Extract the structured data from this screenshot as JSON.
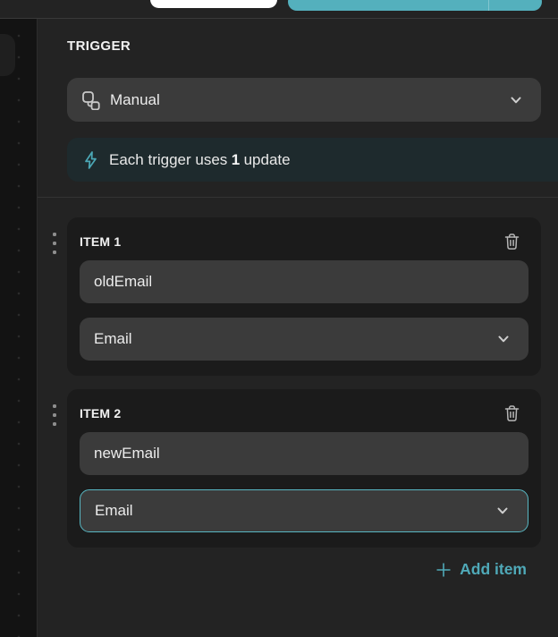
{
  "colors": {
    "accent_teal": "#54b0bd",
    "focus_border": "#58b7c3",
    "add_item_teal": "#4fa9b8",
    "panel_bg": "#232323",
    "card_bg": "#1b1b1b",
    "control_bg": "#3b3b3b",
    "notice_bg": "#1e2a2d",
    "secondary_button_color": "#ffffff"
  },
  "trigger_section": {
    "label": "TRIGGER",
    "type_select": {
      "value": "Manual",
      "icon": "workflow-nodes-icon",
      "chevron_icon": "chevron-down-icon"
    },
    "notice": {
      "icon": "lightning-icon",
      "prefix": "Each trigger uses",
      "count": "1",
      "suffix": "update"
    }
  },
  "items": [
    {
      "label": "ITEM 1",
      "name_value": "oldEmail",
      "type_value": "Email",
      "focused": false
    },
    {
      "label": "ITEM 2",
      "name_value": "newEmail",
      "type_value": "Email",
      "focused": true
    }
  ],
  "add_item": {
    "label": "Add item",
    "icon": "plus-icon"
  }
}
